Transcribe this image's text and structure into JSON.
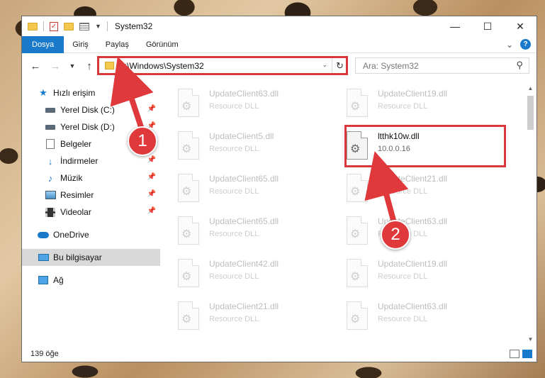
{
  "window": {
    "title": "System32",
    "controls": {
      "minimize": "—",
      "maximize": "☐",
      "close": "✕"
    }
  },
  "ribbon": {
    "tabs": [
      "Dosya",
      "Giriş",
      "Paylaş",
      "Görünüm"
    ],
    "help": "?"
  },
  "address": {
    "path": "C:\\Windows\\System32",
    "refresh": "↻"
  },
  "search": {
    "placeholder": "Ara: System32"
  },
  "sidebar": {
    "items": [
      {
        "label": "Hızlı erişim",
        "icon": "star-icon",
        "pinned": false
      },
      {
        "label": "Yerel Disk (C:)",
        "icon": "drive-icon",
        "pinned": true
      },
      {
        "label": "Yerel Disk (D:)",
        "icon": "drive-icon",
        "pinned": true
      },
      {
        "label": "Belgeler",
        "icon": "documents-icon",
        "pinned": true
      },
      {
        "label": "İndirmeler",
        "icon": "downloads-icon",
        "pinned": true
      },
      {
        "label": "Müzik",
        "icon": "music-icon",
        "pinned": true
      },
      {
        "label": "Resimler",
        "icon": "pictures-icon",
        "pinned": true
      },
      {
        "label": "Videolar",
        "icon": "videos-icon",
        "pinned": true
      },
      {
        "label": "OneDrive",
        "icon": "onedrive-icon",
        "pinned": false
      },
      {
        "label": "Bu bilgisayar",
        "icon": "this-pc-icon",
        "pinned": false
      },
      {
        "label": "Ağ",
        "icon": "network-icon",
        "pinned": false
      }
    ]
  },
  "files": {
    "left": [
      {
        "name": "UpdateClient63.dll",
        "type": "Resource DLL"
      },
      {
        "name": "UpdateClient5.dll",
        "type": "Resource DLL"
      },
      {
        "name": "UpdateClient65.dll",
        "type": "Resource DLL"
      },
      {
        "name": "UpdateClient65.dll",
        "type": "Resource DLL"
      },
      {
        "name": "UpdateClient42.dll",
        "type": "Resource DLL"
      },
      {
        "name": "UpdateClient21.dll",
        "type": "Resource DLL"
      }
    ],
    "right": [
      {
        "name": "UpdateClient19.dll",
        "type": "Resource DLL"
      },
      {
        "name": "ltthk10w.dll",
        "type": "10.0.0.16",
        "highlighted": true
      },
      {
        "name": "UpdateClient21.dll",
        "type": "Resource DLL"
      },
      {
        "name": "UpdateClient63.dll",
        "type": "Resource DLL"
      },
      {
        "name": "UpdateClient19.dll",
        "type": "Resource DLL"
      },
      {
        "name": "UpdateClient63.dll",
        "type": "Resource DLL"
      }
    ]
  },
  "status": {
    "count": "139 öğe"
  },
  "annotations": {
    "badge1": "1",
    "badge2": "2",
    "color": "#d9383a"
  }
}
